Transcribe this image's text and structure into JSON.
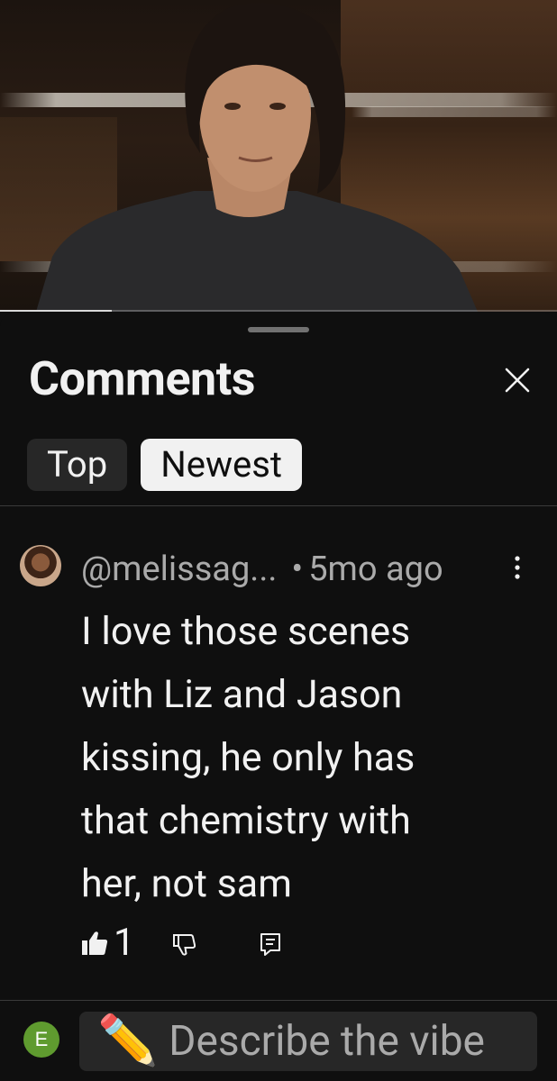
{
  "video": {
    "progress_fraction": 0.2
  },
  "comments_panel": {
    "title": "Comments",
    "close_icon": "close-icon",
    "filters": [
      {
        "label": "Top",
        "selected": false
      },
      {
        "label": "Newest",
        "selected": true
      }
    ]
  },
  "comment": {
    "author": "@melissag...",
    "separator": "•",
    "time": "5mo ago",
    "text": "I love those scenes with Liz and Jason kissing, he only has that chemistry with her, not sam",
    "like_count": "1",
    "icons": [
      "thumbs-up-icon",
      "thumbs-down-icon",
      "reply-icon",
      "more-vertical-icon"
    ]
  },
  "compose": {
    "avatar_letter": "E",
    "pencil": "✏️",
    "placeholder": "Describe the vibe"
  },
  "colors": {
    "background": "#0f0f0f",
    "chip_inactive": "#272727",
    "chip_active": "#f1f1f1",
    "secondary_text": "#aaaaaa",
    "avatar_green": "#5f9b2f"
  }
}
